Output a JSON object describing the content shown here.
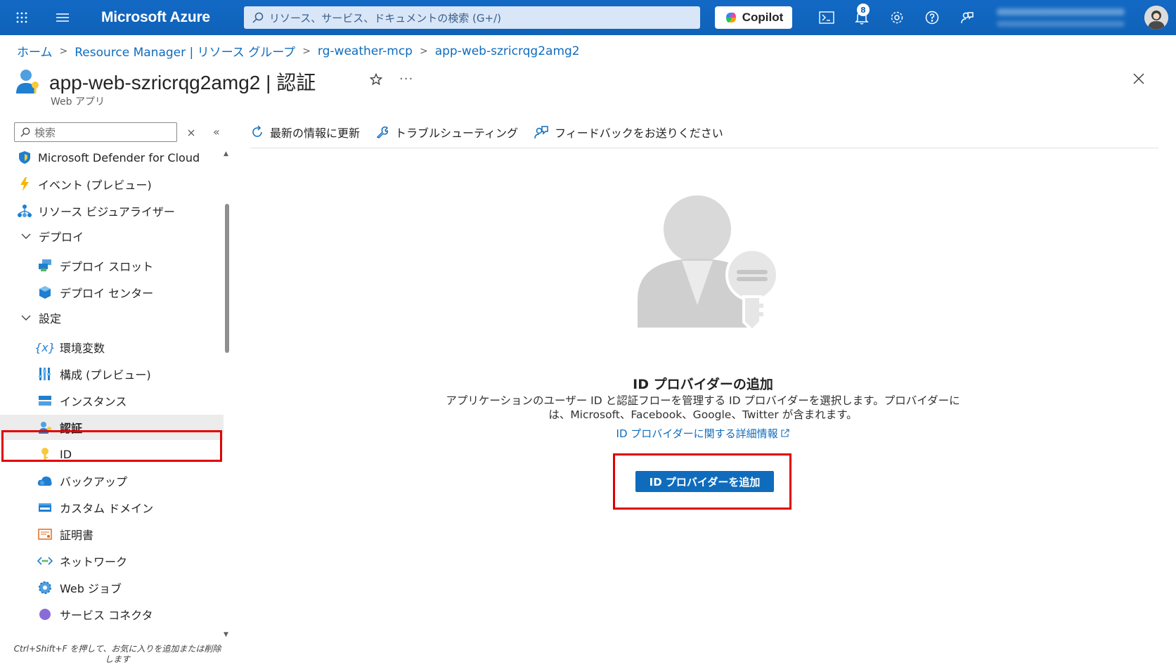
{
  "topbar": {
    "brand": "Microsoft Azure",
    "search_placeholder": "リソース、サービス、ドキュメントの検索 (G+/)",
    "copilot_label": "Copilot",
    "notification_count": "8"
  },
  "breadcrumb": [
    "ホーム",
    "Resource Manager | リソース グループ",
    "rg-weather-mcp",
    "app-web-szricrqg2amg2"
  ],
  "header": {
    "title": "app-web-szricrqg2amg2 | 認証",
    "subtitle": "Web アプリ"
  },
  "sidebar": {
    "search_placeholder": "検索",
    "items": [
      {
        "label": "Microsoft Defender for Cloud",
        "icon": "defender-shield-icon"
      },
      {
        "label": "イベント (プレビュー)",
        "icon": "lightning-icon"
      },
      {
        "label": "リソース ビジュアライザー",
        "icon": "hierarchy-icon"
      },
      {
        "label": "デプロイ",
        "icon": "chevron-down-icon",
        "group": true
      },
      {
        "label": "デプロイ スロット",
        "icon": "deployment-slots-icon"
      },
      {
        "label": "デプロイ センター",
        "icon": "deployment-center-icon"
      },
      {
        "label": "設定",
        "icon": "chevron-down-icon",
        "group": true
      },
      {
        "label": "環境変数",
        "icon": "variable-icon"
      },
      {
        "label": "構成 (プレビュー)",
        "icon": "configuration-icon"
      },
      {
        "label": "インスタンス",
        "icon": "instances-icon"
      },
      {
        "label": "認証",
        "icon": "authentication-icon",
        "selected": true
      },
      {
        "label": "ID",
        "icon": "identity-key-icon"
      },
      {
        "label": "バックアップ",
        "icon": "backup-cloud-icon"
      },
      {
        "label": "カスタム ドメイン",
        "icon": "custom-domain-icon"
      },
      {
        "label": "証明書",
        "icon": "certificate-icon"
      },
      {
        "label": "ネットワーク",
        "icon": "networking-icon"
      },
      {
        "label": "Web ジョブ",
        "icon": "webjobs-icon"
      },
      {
        "label": "サービス コネクタ",
        "icon": "service-connector-icon"
      }
    ],
    "hint": "Ctrl+Shift+F を押して、お気に入りを追加または削除します"
  },
  "toolbar": {
    "refresh": "最新の情報に更新",
    "troubleshoot": "トラブルシューティング",
    "feedback": "フィードバックをお送りください"
  },
  "main": {
    "heading": "ID プロバイダーの追加",
    "description": "アプリケーションのユーザー ID と認証フローを管理する ID プロバイダーを選択します。プロバイダーには、Microsoft、Facebook、Google、Twitter が含まれます。",
    "learn_more": "ID プロバイダーに関する詳細情報",
    "add_button": "ID プロバイダーを追加"
  },
  "colors": {
    "topbar": "#0f62b8",
    "accent": "#0f6cbd",
    "highlight": "#e00000"
  }
}
